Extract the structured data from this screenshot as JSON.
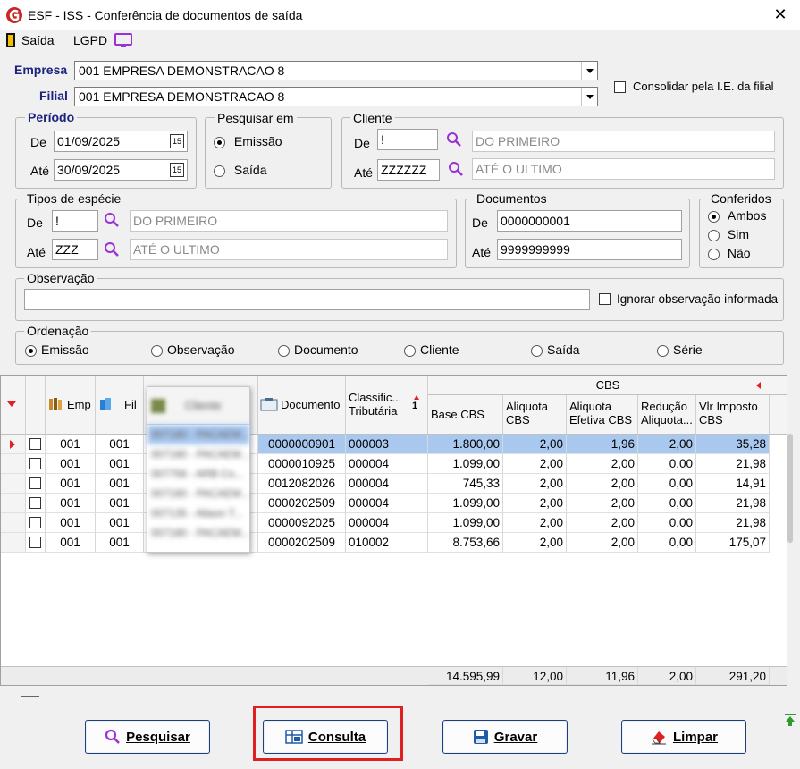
{
  "window": {
    "title": "ESF - ISS - Conferência de documentos de saída",
    "close": "✕"
  },
  "toolbar": {
    "saida": "Saída",
    "lgpd": "LGPD"
  },
  "empresa": {
    "label": "Empresa",
    "value": "001 EMPRESA DEMONSTRACAO 8"
  },
  "filial": {
    "label": "Filial",
    "value": "001 EMPRESA DEMONSTRACAO 8"
  },
  "consolidar": {
    "label": "Consolidar pela I.E. da filial",
    "checked": false
  },
  "periodo": {
    "title": "Período",
    "de_label": "De",
    "de": "01/09/2025",
    "ate_label": "Até",
    "ate": "30/09/2025",
    "cal": "15"
  },
  "pesquisar_em": {
    "title": "Pesquisar em",
    "options": [
      "Emissão",
      "Saída"
    ],
    "selected": "Emissão"
  },
  "cliente": {
    "title": "Cliente",
    "de_label": "De",
    "de_code": "!",
    "de_name": "DO PRIMEIRO",
    "ate_label": "Até",
    "ate_code": "ZZZZZZ",
    "ate_name": "ATÉ O ULTIMO"
  },
  "tipos": {
    "title": "Tipos de espécie",
    "de_label": "De",
    "de_code": "!",
    "de_name": "DO PRIMEIRO",
    "ate_label": "Até",
    "ate_code": "ZZZ",
    "ate_name": "ATÉ O ULTIMO"
  },
  "documentos": {
    "title": "Documentos",
    "de_label": "De",
    "de": "0000000001",
    "ate_label": "Até",
    "ate": "9999999999"
  },
  "conferidos": {
    "title": "Conferidos",
    "options": [
      "Ambos",
      "Sim",
      "Não"
    ],
    "selected": "Ambos"
  },
  "observacao": {
    "title": "Observação",
    "value": "",
    "ignorar_label": "Ignorar observação informada"
  },
  "ordenacao": {
    "title": "Ordenação",
    "options": [
      "Emissão",
      "Observação",
      "Documento",
      "Cliente",
      "Saída",
      "Série"
    ],
    "selected": "Emissão"
  },
  "grid": {
    "group_header": "CBS",
    "columns": {
      "emp": "Emp",
      "fil": "Fil",
      "cliente": "Cliente",
      "documento": "Documento",
      "classif_1": "Classific...",
      "classif_2": "Tributária",
      "sort_badge": "1",
      "base": "Base CBS",
      "aliq_1": "Aliquota",
      "aliq_2": "CBS",
      "aliq_ef_1": "Aliquota",
      "aliq_ef_2": "Efetiva CBS",
      "red_1": "Redução",
      "red_2": "Aliquota...",
      "vlr_1": "Vlr Imposto",
      "vlr_2": "CBS"
    },
    "rows": [
      {
        "emp": "001",
        "fil": "001",
        "cliente": "007180 - PACAEM...",
        "documento": "0000000901",
        "classif": "000003",
        "base": "1.800,00",
        "aliq": "2,00",
        "aliq_ef": "1,96",
        "red": "2,00",
        "vlr": "35,28",
        "selected": true
      },
      {
        "emp": "001",
        "fil": "001",
        "cliente": "007180 - PACAEM...",
        "documento": "0000010925",
        "classif": "000004",
        "base": "1.099,00",
        "aliq": "2,00",
        "aliq_ef": "2,00",
        "red": "0,00",
        "vlr": "21,98",
        "selected": false
      },
      {
        "emp": "001",
        "fil": "001",
        "cliente": "007756 - ARB Co...",
        "documento": "0012082026",
        "classif": "000004",
        "base": "745,33",
        "aliq": "2,00",
        "aliq_ef": "2,00",
        "red": "0,00",
        "vlr": "14,91",
        "selected": false
      },
      {
        "emp": "001",
        "fil": "001",
        "cliente": "007180 - PACAEM...",
        "documento": "0000202509",
        "classif": "000004",
        "base": "1.099,00",
        "aliq": "2,00",
        "aliq_ef": "2,00",
        "red": "0,00",
        "vlr": "21,98",
        "selected": false
      },
      {
        "emp": "001",
        "fil": "001",
        "cliente": "007135 - Allaon T...",
        "documento": "0000092025",
        "classif": "000004",
        "base": "1.099,00",
        "aliq": "2,00",
        "aliq_ef": "2,00",
        "red": "0,00",
        "vlr": "21,98",
        "selected": false
      },
      {
        "emp": "001",
        "fil": "001",
        "cliente": "007180 - PACAEM...",
        "documento": "0000202509",
        "classif": "010002",
        "base": "8.753,66",
        "aliq": "2,00",
        "aliq_ef": "2,00",
        "red": "0,00",
        "vlr": "175,07",
        "selected": false
      }
    ],
    "totals": {
      "base": "14.595,99",
      "aliq": "12,00",
      "aliq_ef": "11,96",
      "red": "2,00",
      "vlr": "291,20"
    }
  },
  "buttons": {
    "pesquisar": "Pesquisar",
    "consulta": "Consulta",
    "gravar": "Gravar",
    "limpar": "Limpar"
  },
  "colors": {
    "highlight": "#e02020",
    "label_blue": "#1a237e",
    "selected_row": "#a9c8f0",
    "icon_purple": "#9b30d9"
  }
}
